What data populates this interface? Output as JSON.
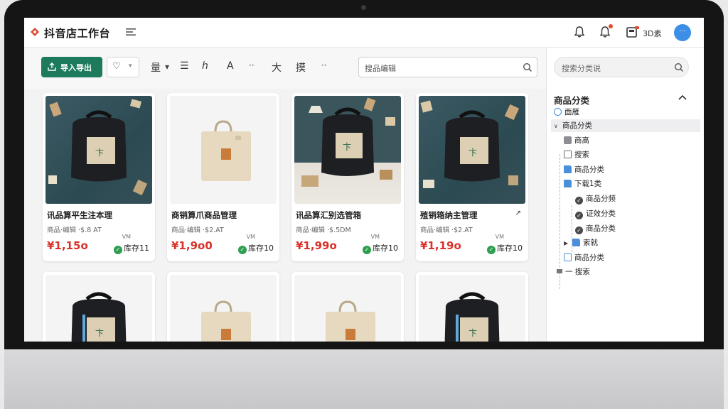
{
  "app": {
    "title": "抖音店工作台",
    "store_label": "3D素",
    "avatar_text": "···"
  },
  "toolbar": {
    "import_export": "导入导出",
    "tag_select": "♡",
    "tools": [
      "量",
      "☰",
      "ℎ",
      "A",
      "··",
      "大",
      "摸",
      "··"
    ],
    "search_placeholder": "搜品编辑"
  },
  "products": [
    {
      "title": "讯品算平生注本理",
      "sub": "商品·编辑 ·$.8 AT",
      "vm": "VM",
      "price": "¥1,15o",
      "stock": "库存11",
      "share": ""
    },
    {
      "title": "商销算爪商品管理",
      "sub": "商品·编辑 ·$2.AT",
      "vm": "VM",
      "price": "¥1,9o0",
      "stock": "库存10",
      "share": ""
    },
    {
      "title": "讯品算汇别选管箱",
      "sub": "商品·编辑 ·$.5DM",
      "vm": "VM",
      "price": "¥1,99o",
      "stock": "库存10",
      "share": ""
    },
    {
      "title": "殖销箱纳主管理",
      "sub": "商品·编辑 ·$2.AT",
      "vm": "VM",
      "price": "¥1,19o",
      "stock": "库存10",
      "share": "↗"
    }
  ],
  "sidebar": {
    "search_placeholder": "搜索分类说",
    "category_header": "商品分类",
    "tree": [
      {
        "label": "面雁"
      },
      {
        "label": "商品分类"
      },
      {
        "label": "商高"
      },
      {
        "label": "搜索"
      },
      {
        "label": "商品分类"
      },
      {
        "label": "下载1类"
      },
      {
        "label": "商品分频"
      },
      {
        "label": "证效分类"
      },
      {
        "label": "商品分类"
      },
      {
        "label": "索就"
      },
      {
        "label": "商品分类"
      },
      {
        "label": "一 搜索"
      }
    ]
  },
  "colors": {
    "accent": "#1d7a5c",
    "price": "#d8322a",
    "stock_ok": "#2e9e4f",
    "avatar": "#3d8ee6"
  }
}
